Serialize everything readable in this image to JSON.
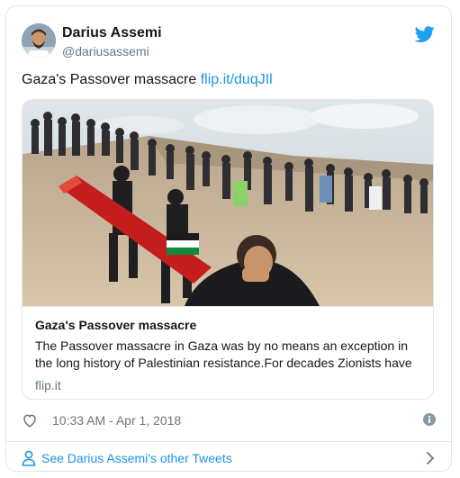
{
  "author": {
    "name": "Darius Assemi",
    "handle": "@dariusassemi"
  },
  "tweet": {
    "text": "Gaza's Passover massacre",
    "link": "flip.it/duqJIl"
  },
  "card": {
    "title": "Gaza's Passover massacre",
    "description": "The Passover massacre in Gaza was by no means an exception in the long history of Palestinian resistance.For decades Zionists have",
    "domain": "flip.it"
  },
  "meta": {
    "timestamp": "10:33 AM - Apr 1, 2018"
  },
  "footer": {
    "label": "See Darius Assemi's other Tweets"
  },
  "icons": {
    "brand": "twitter-bird-icon",
    "like": "heart-icon",
    "info": "info-icon",
    "profile": "person-icon",
    "more": "chevron-right-icon"
  },
  "colors": {
    "brand_blue": "#1da1f2",
    "link_blue": "#1b95e0",
    "text": "#14171a",
    "muted": "#657786",
    "border": "#e1e8ed"
  }
}
